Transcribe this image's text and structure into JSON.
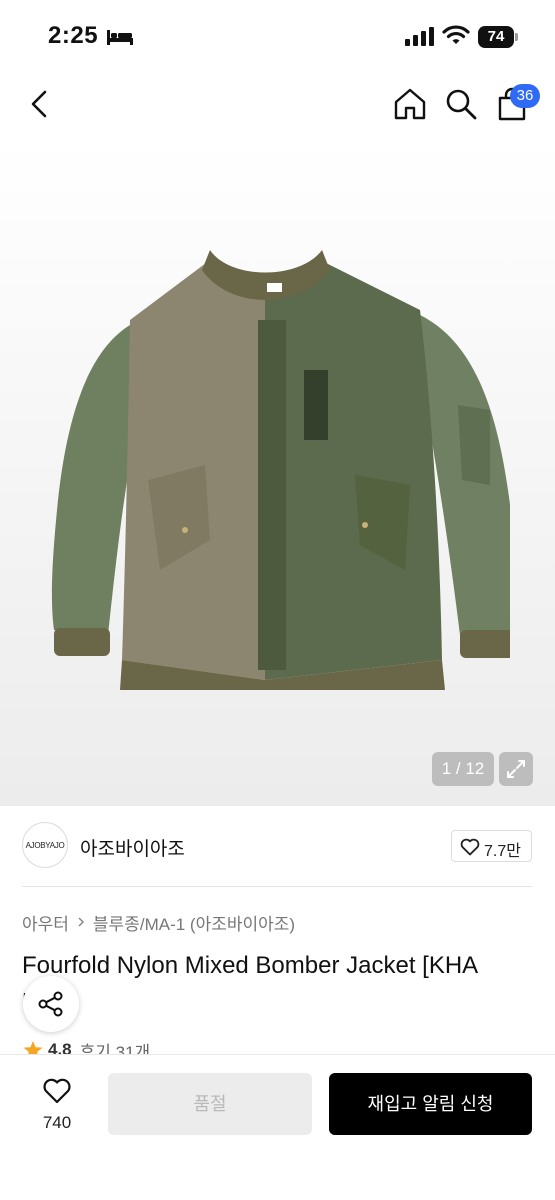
{
  "status_bar": {
    "time": "2:25",
    "battery": "74",
    "icons": [
      "bed-icon",
      "signal-icon",
      "wifi-icon",
      "battery-icon"
    ]
  },
  "nav": {
    "icons": [
      "back-icon",
      "home-icon",
      "search-icon",
      "cart-icon"
    ],
    "cart_badge": "36"
  },
  "gallery": {
    "counter": "1 / 12",
    "expand_icon": "expand-icon"
  },
  "brand": {
    "logo_text": "AJOBYAJO",
    "name": "아조바이아조",
    "like_count": "7.7만"
  },
  "product": {
    "breadcrumb": [
      "아우터",
      "블루종/MA-1 (아조바이아조)"
    ],
    "title": "Fourfold Nylon Mixed Bomber Jacket [KHA",
    "title_overflow": "I",
    "rating": "4.8",
    "review_count": "후기 31개"
  },
  "bottom_bar": {
    "wish_count": "740",
    "soldout_label": "품절",
    "restock_label": "재입고 알림 신청"
  },
  "colors": {
    "accent_badge": "#2f6af6",
    "star": "#f5a623",
    "primary_button": "#000000",
    "disabled_button": "#ececec"
  }
}
